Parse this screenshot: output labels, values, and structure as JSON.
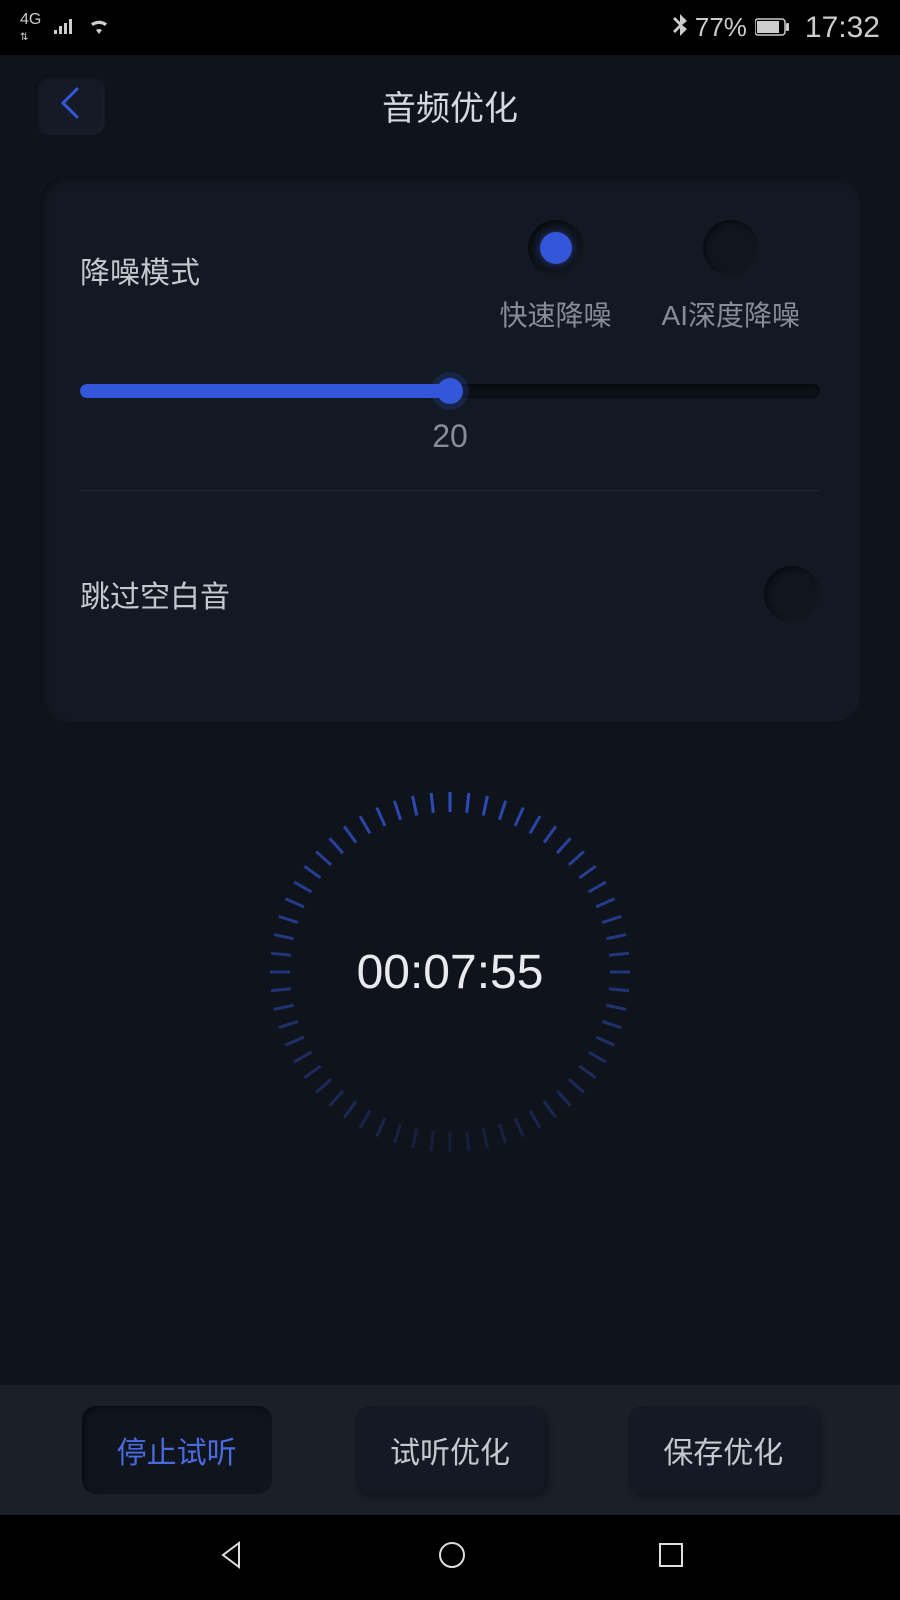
{
  "statusBar": {
    "network": "4G",
    "bluetooth": "bluetooth-icon",
    "battery": "77%",
    "time": "17:32"
  },
  "header": {
    "title": "音频优化"
  },
  "noiseReduction": {
    "label": "降噪模式",
    "options": {
      "fast": "快速降噪",
      "aiDeep": "AI深度降噪"
    },
    "sliderValue": "20"
  },
  "skipSilence": {
    "label": "跳过空白音"
  },
  "timer": {
    "value": "00:07:55"
  },
  "actions": {
    "stop": "停止试听",
    "preview": "试听优化",
    "save": "保存优化"
  }
}
